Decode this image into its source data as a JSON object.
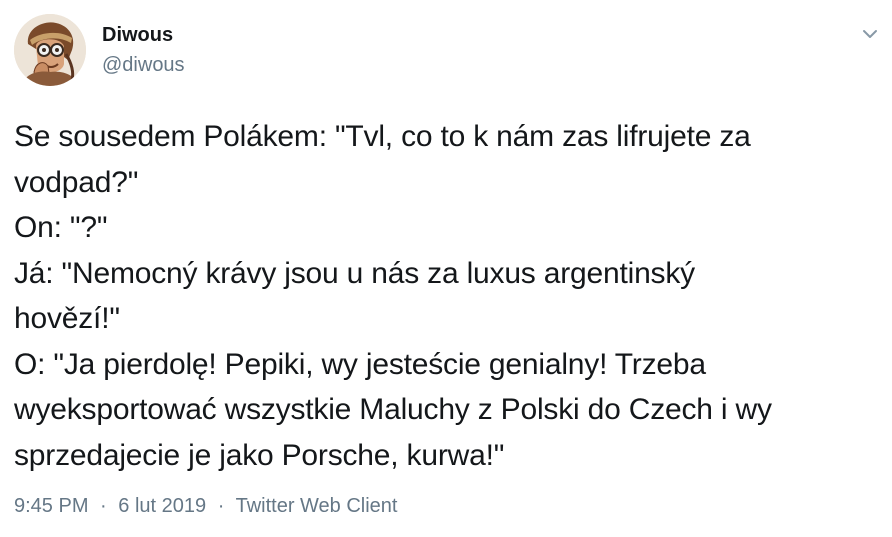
{
  "author": {
    "display_name": "Diwous",
    "handle": "@diwous",
    "avatar_icon": "cartoon-face-avatar"
  },
  "tweet": {
    "lines": [
      "Se sousedem Polákem: \"Tvl, co to k nám zas lifrujete za",
      "vodpad?\"",
      "On: \"?\"",
      "Já: \"Nemocný krávy jsou u nás za luxus argentinský",
      "hovězí!\"",
      "O: \"Ja pierdolę! Pepiki, wy jesteście genialny! Trzeba",
      "wyeksportować wszystkie Maluchy z Polski do Czech i wy",
      "sprzedajecie je jako Porsche, kurwa!\""
    ]
  },
  "meta": {
    "time": "9:45 PM",
    "separator": "·",
    "date": "6 lut 2019",
    "client": "Twitter Web Client"
  },
  "icons": {
    "more_menu": "chevron-down-icon"
  },
  "colors": {
    "text": "#14171a",
    "secondary": "#657786",
    "background": "#ffffff"
  }
}
